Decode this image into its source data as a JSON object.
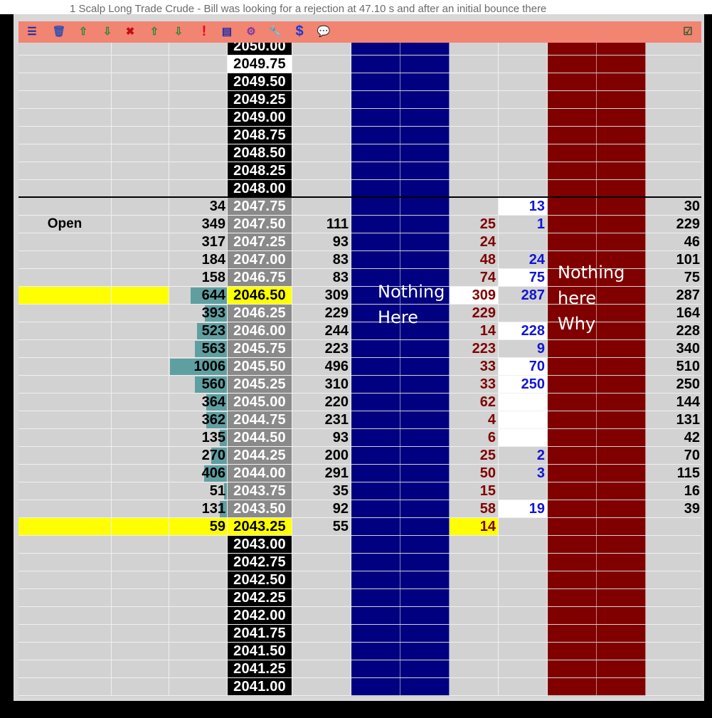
{
  "colors": {
    "toolbar_bg": "#f28472",
    "grid_bg": "#d2d2d2",
    "grid_lines": "#f0f0f0",
    "price_bg_black": "#000000",
    "price_bg_gray": "#8a8a8a",
    "highlight_yellow": "#ffff00",
    "volume_bar": "#5f9fa1",
    "bid_column_blue": "#000080",
    "ask_column_red": "#800000",
    "blue_text": "#1016d6",
    "red_text": "#800000"
  },
  "title_fragment": "1   Scalp Long Trade Crude - Bill was looking for a rejection at 47.10 s and after an initial bounce there",
  "toolbar": {
    "icons": [
      "ladder-center-icon",
      "trash-icon",
      "arrow-up-icon",
      "arrow-down-icon",
      "cancel-orders-icon",
      "arrow-up-icon",
      "arrow-down-icon",
      "alert-icon",
      "chart-icon",
      "group-icon",
      "wrench-icon",
      "dollar-icon",
      "chat-icon"
    ],
    "right_icon": "checklist-icon"
  },
  "annotations": {
    "blue_note": [
      "Nothing",
      "Here"
    ],
    "red_note": [
      "Nothing",
      "here",
      "Why"
    ]
  },
  "ladder": {
    "rows": [
      {
        "price": "2050.00",
        "price_style": "black"
      },
      {
        "price": "2049.75",
        "price_style": "white"
      },
      {
        "price": "2049.50",
        "price_style": "black"
      },
      {
        "price": "2049.25",
        "price_style": "black"
      },
      {
        "price": "2049.00",
        "price_style": "black"
      },
      {
        "price": "2048.75",
        "price_style": "black"
      },
      {
        "price": "2048.50",
        "price_style": "black"
      },
      {
        "price": "2048.25",
        "price_style": "black"
      },
      {
        "price": "2048.00",
        "price_style": "black"
      },
      {
        "price": "2047.75",
        "price_style": "gray",
        "vol": "34",
        "bar": 0.0,
        "sold": "",
        "bought": "13",
        "bought_white": true,
        "right": "30"
      },
      {
        "label": "Open",
        "price": "2047.50",
        "price_style": "gray",
        "vol": "349",
        "bar": 0.0,
        "trades": "111",
        "sold": "25",
        "bought": "1",
        "right": "229"
      },
      {
        "price": "2047.25",
        "price_style": "gray",
        "vol": "317",
        "bar": 0.0,
        "trades": "93",
        "sold": "24",
        "bought": "",
        "right": "46"
      },
      {
        "price": "2047.00",
        "price_style": "gray",
        "vol": "184",
        "bar": 0.0,
        "trades": "83",
        "sold": "48",
        "bought": "24",
        "right": "101"
      },
      {
        "price": "2046.75",
        "price_style": "gray",
        "vol": "158",
        "bar": 0.0,
        "trades": "83",
        "sold": "74",
        "bought": "75",
        "bought_white": true,
        "right": "75"
      },
      {
        "yellow_left": true,
        "price": "2046.50",
        "price_style": "yellow",
        "vol": "644",
        "bar": 0.64,
        "trades": "309",
        "sold": "309",
        "sold_white": true,
        "bought": "287",
        "right": "287"
      },
      {
        "price": "2046.25",
        "price_style": "gray",
        "vol": "393",
        "bar": 0.39,
        "trades": "229",
        "sold": "229",
        "bought": "",
        "right": "164"
      },
      {
        "price": "2046.00",
        "price_style": "gray",
        "vol": "523",
        "bar": 0.52,
        "trades": "244",
        "sold": "14",
        "bought": "228",
        "bought_white": true,
        "right": "228"
      },
      {
        "price": "2045.75",
        "price_style": "gray",
        "vol": "563",
        "bar": 0.56,
        "trades": "223",
        "sold": "223",
        "bought": "9",
        "right": "340"
      },
      {
        "price": "2045.50",
        "price_style": "gray",
        "vol": "1006",
        "bar": 1.0,
        "trades": "496",
        "sold": "33",
        "bought": "70",
        "bought_white": true,
        "right": "510"
      },
      {
        "price": "2045.25",
        "price_style": "gray",
        "vol": "560",
        "bar": 0.56,
        "trades": "310",
        "sold": "33",
        "bought": "250",
        "bought_white": true,
        "right": "250"
      },
      {
        "price": "2045.00",
        "price_style": "gray",
        "vol": "364",
        "bar": 0.36,
        "trades": "220",
        "sold": "62",
        "bought": "",
        "bought_white": true,
        "right": "144"
      },
      {
        "price": "2044.75",
        "price_style": "gray",
        "vol": "362",
        "bar": 0.36,
        "trades": "231",
        "sold": "4",
        "bought": "",
        "bought_white": true,
        "right": "131"
      },
      {
        "price": "2044.50",
        "price_style": "gray",
        "vol": "135",
        "bar": 0.13,
        "trades": "93",
        "sold": "6",
        "bought": "",
        "bought_white": true,
        "right": "42"
      },
      {
        "price": "2044.25",
        "price_style": "gray",
        "vol": "270",
        "bar": 0.27,
        "trades": "200",
        "sold": "25",
        "bought": "2",
        "right": "70"
      },
      {
        "price": "2044.00",
        "price_style": "gray",
        "vol": "406",
        "bar": 0.4,
        "trades": "291",
        "sold": "50",
        "bought": "3",
        "right": "115"
      },
      {
        "price": "2043.75",
        "price_style": "gray",
        "vol": "51",
        "bar": 0.05,
        "trades": "35",
        "sold": "15",
        "bought": "",
        "right": "16"
      },
      {
        "price": "2043.50",
        "price_style": "gray",
        "vol": "131",
        "bar": 0.13,
        "trades": "92",
        "sold": "58",
        "bought": "19",
        "bought_white": true,
        "right": "39"
      },
      {
        "yellow_left": true,
        "price": "2043.25",
        "price_style": "yellow",
        "vol": "59",
        "bar": 0.0,
        "trades": "55",
        "sold": "14",
        "sold_yellow": true,
        "bought": ""
      },
      {
        "price": "2043.00",
        "price_style": "black"
      },
      {
        "price": "2042.75",
        "price_style": "black"
      },
      {
        "price": "2042.50",
        "price_style": "black"
      },
      {
        "price": "2042.25",
        "price_style": "black"
      },
      {
        "price": "2042.00",
        "price_style": "black"
      },
      {
        "price": "2041.75",
        "price_style": "black"
      },
      {
        "price": "2041.50",
        "price_style": "black"
      },
      {
        "price": "2041.25",
        "price_style": "black"
      },
      {
        "price": "2041.00",
        "price_style": "black"
      }
    ]
  }
}
